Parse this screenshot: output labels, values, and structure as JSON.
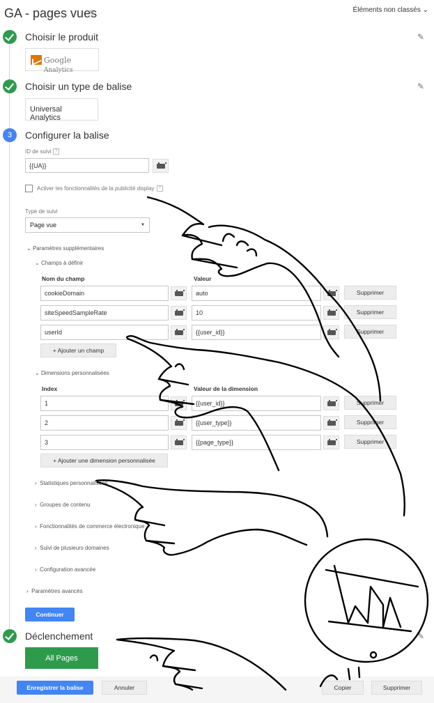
{
  "header": {
    "title": "GA - pages vues",
    "folder_label": "Éléments non classés"
  },
  "steps": {
    "product": {
      "title": "Choisir le produit",
      "logo_brand": "Google",
      "logo_product": "Analytics"
    },
    "tag_type": {
      "title": "Choisir un type de balise",
      "value": "Universal Analytics"
    },
    "configure": {
      "number": "3",
      "title": "Configurer la balise",
      "tracking_id_label": "ID de suivi",
      "help_mark": "?",
      "tracking_id_value": "{{UA}}",
      "display_features_label": "Activer les fonctionnalités de la publicité display",
      "tracking_type_label": "Type de suivi",
      "tracking_type_value": "Page vue",
      "more_settings_label": "Paramètres supplémentaires",
      "fields_to_set_label": "Champs à définir",
      "field_name_header": "Nom du champ",
      "value_header": "Valeur",
      "fields": [
        {
          "name": "cookieDomain",
          "value": "auto"
        },
        {
          "name": "siteSpeedSampleRate",
          "value": "10"
        },
        {
          "name": "userId",
          "value": "{{user_id}}"
        }
      ],
      "delete_label": "Supprimer",
      "add_field_label": "+ Ajouter un champ",
      "custom_dimensions_label": "Dimensions personnalisées",
      "index_header": "Index",
      "dimension_value_header": "Valeur de la dimension",
      "dimensions": [
        {
          "index": "1",
          "value": "{{user_id}}"
        },
        {
          "index": "2",
          "value": "{{user_type}}"
        },
        {
          "index": "3",
          "value": "{{page_type}}"
        }
      ],
      "add_dimension_label": "+ Ajouter une dimension personnalisée",
      "collapsed_sections": [
        "Statistiques personnalisées",
        "Groupes de contenu",
        "Fonctionnalités de commerce électronique",
        "Suivi de plusieurs domaines",
        "Configuration avancée"
      ],
      "advanced_settings_label": "Paramètres avancés",
      "continue_label": "Continuer"
    },
    "trigger": {
      "title": "Déclenchement",
      "value": "All Pages"
    }
  },
  "footer": {
    "save_label": "Enregistrer la balise",
    "cancel_label": "Annuler",
    "copy_label": "Copier",
    "delete_label": "Supprimer"
  },
  "icons": {
    "edit": "pencil-icon",
    "check": "check-circle-icon",
    "variable": "variable-picker-icon",
    "expand": "chevron-down-icon",
    "collapse": "chevron-right-icon"
  },
  "colors": {
    "accent_blue": "#4285f4",
    "success_green": "#2e9b4c",
    "ga_orange": "#e37400"
  }
}
